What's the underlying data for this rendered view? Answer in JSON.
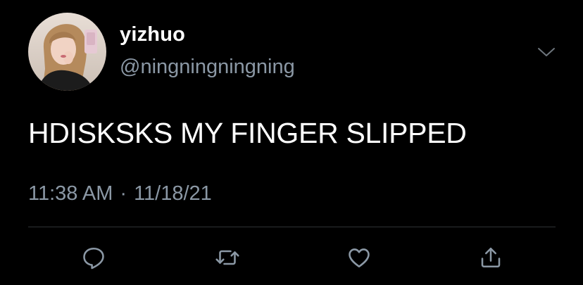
{
  "tweet": {
    "author": {
      "display_name": "yizhuo",
      "handle": "@ningningningning"
    },
    "text": "HDISKSKS MY FINGER SLIPPED",
    "time": "11:38 AM",
    "separator": "·",
    "date": "11/18/21"
  },
  "actions": [
    {
      "name": "reply",
      "icon": "reply-icon"
    },
    {
      "name": "retweet",
      "icon": "retweet-icon"
    },
    {
      "name": "like",
      "icon": "heart-icon"
    },
    {
      "name": "share",
      "icon": "share-icon"
    }
  ],
  "colors": {
    "background": "#000000",
    "primary_text": "#ffffff",
    "secondary_text": "#8b98a5",
    "divider": "#2f3336"
  }
}
